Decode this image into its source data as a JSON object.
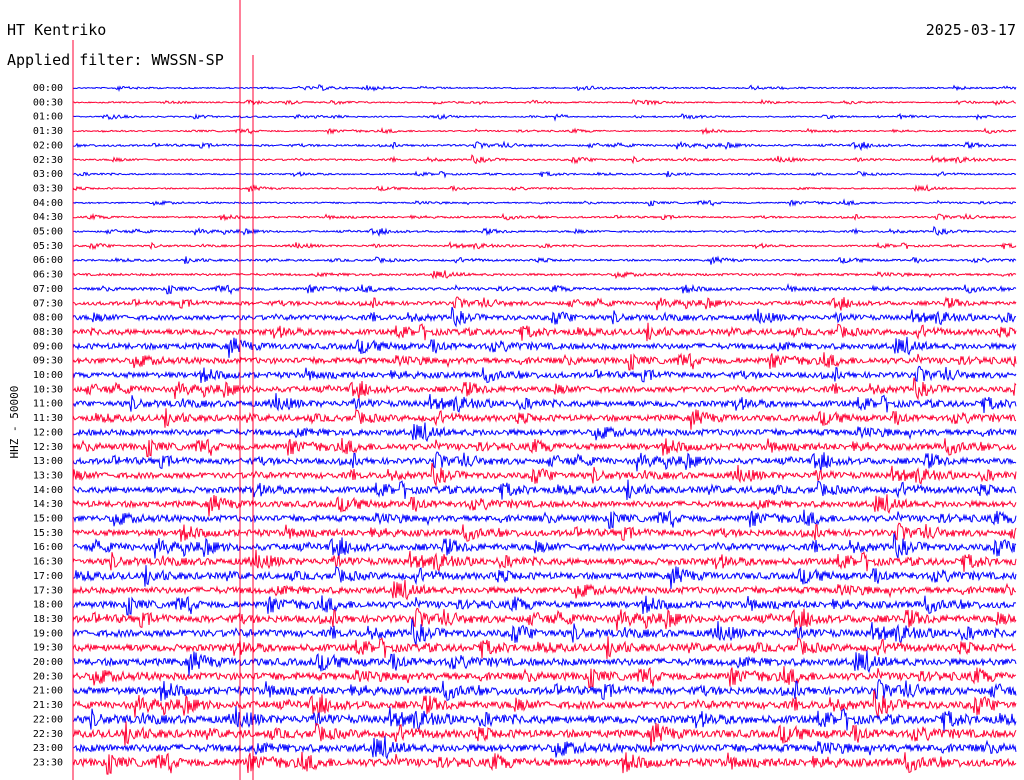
{
  "header": {
    "station": "HT Kentriko",
    "date": "2025-03-17",
    "filter": "Applied filter: WWSSN-SP"
  },
  "chart_data": {
    "type": "line",
    "ylabel": "HHZ - 50000",
    "row_labels": [
      "00:00",
      "00:30",
      "01:00",
      "01:30",
      "02:00",
      "02:30",
      "03:00",
      "03:30",
      "04:00",
      "04:30",
      "05:00",
      "05:30",
      "06:00",
      "06:30",
      "07:00",
      "07:30",
      "08:00",
      "08:30",
      "09:00",
      "09:30",
      "10:00",
      "10:30",
      "11:00",
      "11:30",
      "12:00",
      "12:30",
      "13:00",
      "13:30",
      "14:00",
      "14:30",
      "15:00",
      "15:30",
      "16:00",
      "16:30",
      "17:00",
      "17:30",
      "18:00",
      "18:30",
      "19:00",
      "19:30",
      "20:00",
      "20:30",
      "21:00",
      "21:30",
      "22:00",
      "22:30",
      "23:00",
      "23:30"
    ],
    "series_colors": [
      "#0000ff",
      "#ff0033"
    ],
    "activity": [
      0.03,
      0.03,
      0.02,
      0.03,
      0.12,
      0.1,
      0.05,
      0.04,
      0.06,
      0.08,
      0.1,
      0.08,
      0.12,
      0.18,
      0.25,
      0.4,
      0.55,
      0.65,
      0.7,
      0.7,
      0.65,
      0.65,
      0.7,
      0.7,
      0.75,
      0.75,
      0.7,
      0.7,
      0.75,
      0.75,
      0.75,
      0.75,
      0.8,
      0.8,
      0.8,
      0.8,
      0.8,
      0.85,
      0.85,
      0.85,
      0.9,
      0.9,
      0.9,
      0.9,
      0.95,
      0.95,
      0.95,
      0.95
    ]
  }
}
